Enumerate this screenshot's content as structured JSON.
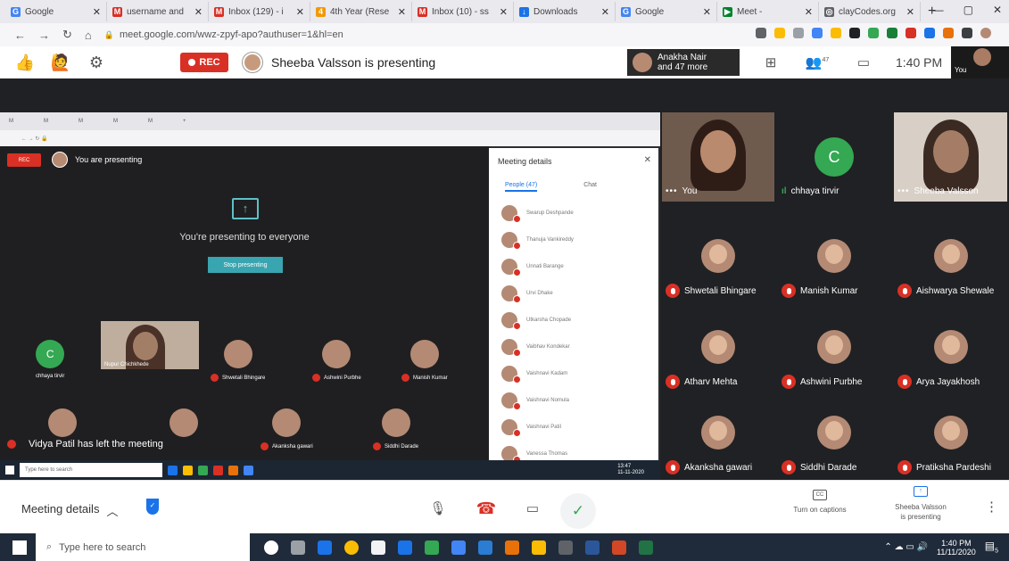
{
  "browser": {
    "tabs": [
      {
        "title": "Google",
        "color": "#4285f4",
        "glyph": "G"
      },
      {
        "title": "username and",
        "color": "#d93025",
        "glyph": "M"
      },
      {
        "title": "Inbox (129) - i",
        "color": "#d93025",
        "glyph": "M"
      },
      {
        "title": "4th Year (Rese",
        "color": "#f29900",
        "glyph": "4"
      },
      {
        "title": "Inbox (10) - ss",
        "color": "#d93025",
        "glyph": "M"
      },
      {
        "title": "Downloads",
        "color": "#1a73e8",
        "glyph": "↓"
      },
      {
        "title": "Google",
        "color": "#4285f4",
        "glyph": "G"
      },
      {
        "title": "Meet - ",
        "color": "#00832d",
        "glyph": "▶"
      },
      {
        "title": "clayCodes.org",
        "color": "#5f6368",
        "glyph": "◎"
      }
    ],
    "url": "meet.google.com/wwz-zpyf-apo?authuser=1&hl=en"
  },
  "meet": {
    "rec_label": "REC",
    "presenting": "Sheeba Valsson is presenting",
    "participants_line1": "Anakha Nair",
    "participants_line2": "and 47 more",
    "people_count": "47",
    "time": "1:40 PM",
    "you_label": "You"
  },
  "shared": {
    "rec": "REC",
    "you_are_presenting": "You are presenting",
    "presenting_to_everyone": "You're presenting to everyone",
    "stop_presenting": "Stop presenting",
    "meeting_details": "Meeting details",
    "people_tab": "People (47)",
    "chat_tab": "Chat",
    "people": [
      "Swarup Deshpande",
      "Thanuja Vankireddy",
      "Unnati Barange",
      "Urvi Dhake",
      "Utkarsha Chopade",
      "Vaibhav Kondekar",
      "Vaishnavi Kadam",
      "Vaishnavi Nomula",
      "Vaishnavi Patil",
      "Vanessa Thomas"
    ],
    "chhaya": "chhaya tirvir",
    "nupur": "Nupur Chichkhede",
    "shwetali": "Shwetali Bhingare",
    "ashwini": "Ashwini Purbhe",
    "manish": "Manish Kumar",
    "akanksha": "Akanksha gawari",
    "siddhi": "Siddhi Darade",
    "left_note": "Vidya Patil has left the meeting",
    "search": "Type here to search",
    "time": "13:47",
    "date": "11-11-2020"
  },
  "tiles": {
    "you": "You",
    "chhaya": "chhaya tirvir",
    "chhaya_initial": "C",
    "sheeba": "Sheeba Valsson",
    "shwetali": "Shwetali Bhingare",
    "manish": "Manish Kumar",
    "aishwarya": "Aishwarya Shewale",
    "atharv": "Atharv Mehta",
    "ashwini": "Ashwini Purbhe",
    "arya": "Arya Jayakhosh",
    "akanksha": "Akanksha gawari",
    "siddhi": "Siddhi Darade",
    "pratiksha": "Pratiksha Pardeshi"
  },
  "bottom": {
    "meeting_details": "Meeting details",
    "captions": "Turn on captions",
    "presenting_line1": "Sheeba Valsson",
    "presenting_line2": "is presenting"
  },
  "taskbar": {
    "search": "Type here to search",
    "time": "1:40 PM",
    "date": "11/11/2020",
    "notifications": "5"
  }
}
